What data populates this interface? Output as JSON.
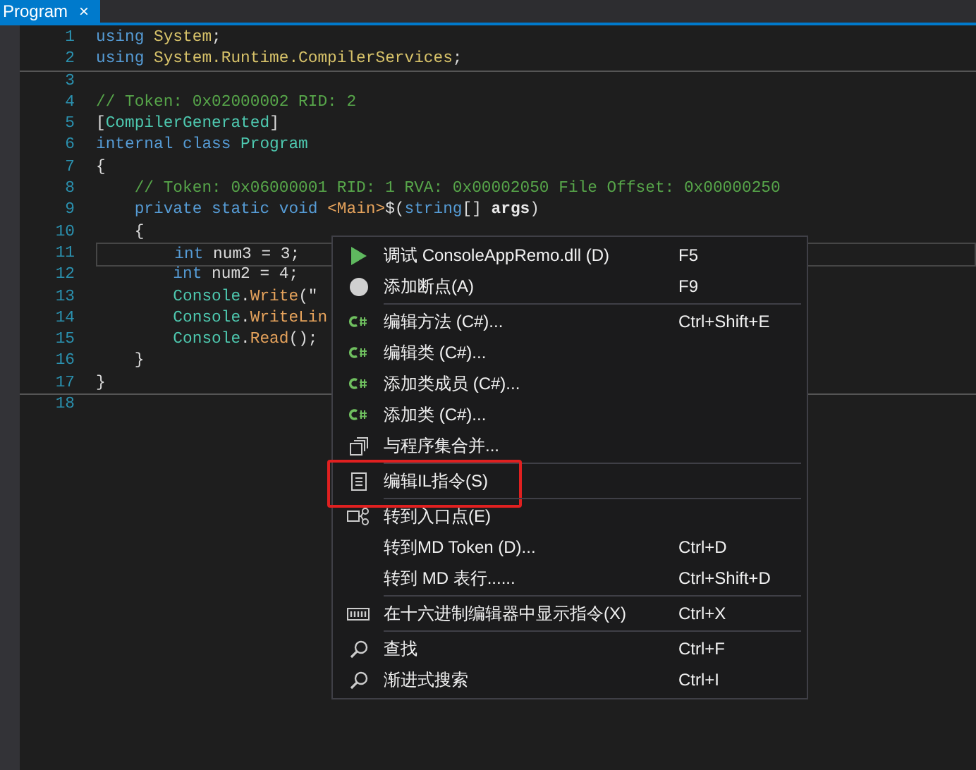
{
  "tab": {
    "title": "Program",
    "close": "×"
  },
  "code": {
    "lines": [
      {
        "number": "1",
        "current": false,
        "tokens": [
          {
            "text": "using ",
            "kind": "keyword"
          },
          {
            "text": "System",
            "kind": "namespace"
          },
          {
            "text": ";",
            "kind": "plain"
          }
        ]
      },
      {
        "number": "2",
        "current": false,
        "tokens": [
          {
            "text": "using ",
            "kind": "keyword"
          },
          {
            "text": "System.Runtime.CompilerServices",
            "kind": "namespace"
          },
          {
            "text": ";",
            "kind": "plain"
          }
        ]
      },
      {
        "number": "3",
        "current": false
      },
      {
        "number": "4",
        "current": false,
        "tokens": [
          {
            "text": "// Token: 0x02000002 RID: 2",
            "kind": "comment"
          }
        ]
      },
      {
        "number": "5",
        "current": false,
        "tokens": [
          {
            "text": "[",
            "kind": "plain"
          },
          {
            "text": "CompilerGenerated",
            "kind": "type"
          },
          {
            "text": "]",
            "kind": "plain"
          }
        ]
      },
      {
        "number": "6",
        "current": false,
        "tokens": [
          {
            "text": "internal class ",
            "kind": "keyword"
          },
          {
            "text": "Program",
            "kind": "type"
          }
        ]
      },
      {
        "number": "7",
        "current": false,
        "tokens": [
          {
            "text": "{",
            "kind": "plain"
          }
        ]
      },
      {
        "number": "8",
        "current": false,
        "tokens": [
          {
            "text": "    // Token: 0x06000001 RID: 1 RVA: 0x00002050 File Offset: 0x00000250",
            "kind": "comment"
          }
        ]
      },
      {
        "number": "9",
        "current": false,
        "tokens": [
          {
            "text": "    private static void ",
            "kind": "keyword"
          },
          {
            "text": "<Main>",
            "kind": "method"
          },
          {
            "text": "$(",
            "kind": "plain"
          },
          {
            "text": "string",
            "kind": "keyword"
          },
          {
            "text": "[] ",
            "kind": "plain"
          },
          {
            "text": "args",
            "kind": "param"
          },
          {
            "text": ")",
            "kind": "plain"
          }
        ]
      },
      {
        "number": "10",
        "current": false,
        "tokens": [
          {
            "text": "    {",
            "kind": "plain"
          }
        ]
      },
      {
        "number": "11",
        "current": true,
        "tokens": [
          {
            "text": "        int",
            "kind": "keyword"
          },
          {
            "text": " num3 = 3;",
            "kind": "plain"
          }
        ]
      },
      {
        "number": "12",
        "current": false,
        "tokens": [
          {
            "text": "        int",
            "kind": "keyword"
          },
          {
            "text": " num2 = 4;",
            "kind": "plain"
          }
        ]
      },
      {
        "number": "13",
        "current": false,
        "tokens": [
          {
            "text": "        Console",
            "kind": "type"
          },
          {
            "text": ".",
            "kind": "plain"
          },
          {
            "text": "Write",
            "kind": "method"
          },
          {
            "text": "(\"",
            "kind": "plain"
          }
        ]
      },
      {
        "number": "14",
        "current": false,
        "tokens": [
          {
            "text": "        Console",
            "kind": "type"
          },
          {
            "text": ".",
            "kind": "plain"
          },
          {
            "text": "WriteLin",
            "kind": "method"
          }
        ]
      },
      {
        "number": "15",
        "current": false,
        "tokens": [
          {
            "text": "        Console",
            "kind": "type"
          },
          {
            "text": ".",
            "kind": "plain"
          },
          {
            "text": "Read",
            "kind": "method"
          },
          {
            "text": "();",
            "kind": "plain"
          }
        ]
      },
      {
        "number": "16",
        "current": false,
        "tokens": [
          {
            "text": "    }",
            "kind": "plain"
          }
        ]
      },
      {
        "number": "17",
        "current": false,
        "tokens": [
          {
            "text": "}",
            "kind": "plain"
          }
        ]
      },
      {
        "number": "18",
        "current": false
      }
    ]
  },
  "context_menu": {
    "items": [
      {
        "kind": "run",
        "label": "调试 ConsoleAppRemo.dll (D)",
        "shortcut": "F5",
        "divider_above": false,
        "highlighted": false
      },
      {
        "kind": "breakpoint",
        "label": "添加断点(A)",
        "shortcut": "F9",
        "divider_above": false,
        "highlighted": false
      },
      {
        "kind": "csharp",
        "label": "编辑方法 (C#)...",
        "shortcut": "Ctrl+Shift+E",
        "divider_above": true,
        "highlighted": false
      },
      {
        "kind": "csharp",
        "label": "编辑类 (C#)...",
        "divider_above": false,
        "highlighted": false
      },
      {
        "kind": "csharp",
        "label": "添加类成员 (C#)...",
        "divider_above": false,
        "highlighted": false
      },
      {
        "kind": "csharp",
        "label": "添加类 (C#)...",
        "divider_above": false,
        "highlighted": false
      },
      {
        "kind": "merge",
        "label": "与程序集合并...",
        "divider_above": false,
        "highlighted": false
      },
      {
        "kind": "il",
        "label": "编辑IL指令(S)",
        "divider_above": true,
        "highlighted": true
      },
      {
        "kind": "entry",
        "label": "转到入口点(E)",
        "divider_above": true,
        "highlighted": false
      },
      {
        "kind": "plain",
        "label": "转到MD Token (D)...",
        "shortcut": "Ctrl+D",
        "divider_above": false,
        "highlighted": false
      },
      {
        "kind": "plain",
        "label": "转到 MD 表行......",
        "shortcut": "Ctrl+Shift+D",
        "divider_above": false,
        "highlighted": false
      },
      {
        "kind": "hex",
        "label": "在十六进制编辑器中显示指令(X)",
        "shortcut": "Ctrl+X",
        "divider_above": true,
        "highlighted": false
      },
      {
        "kind": "search",
        "label": "查找",
        "shortcut": "Ctrl+F",
        "divider_above": true,
        "highlighted": false
      },
      {
        "kind": "search",
        "label": "渐进式搜索",
        "shortcut": "Ctrl+I",
        "divider_above": false,
        "highlighted": false
      }
    ]
  }
}
